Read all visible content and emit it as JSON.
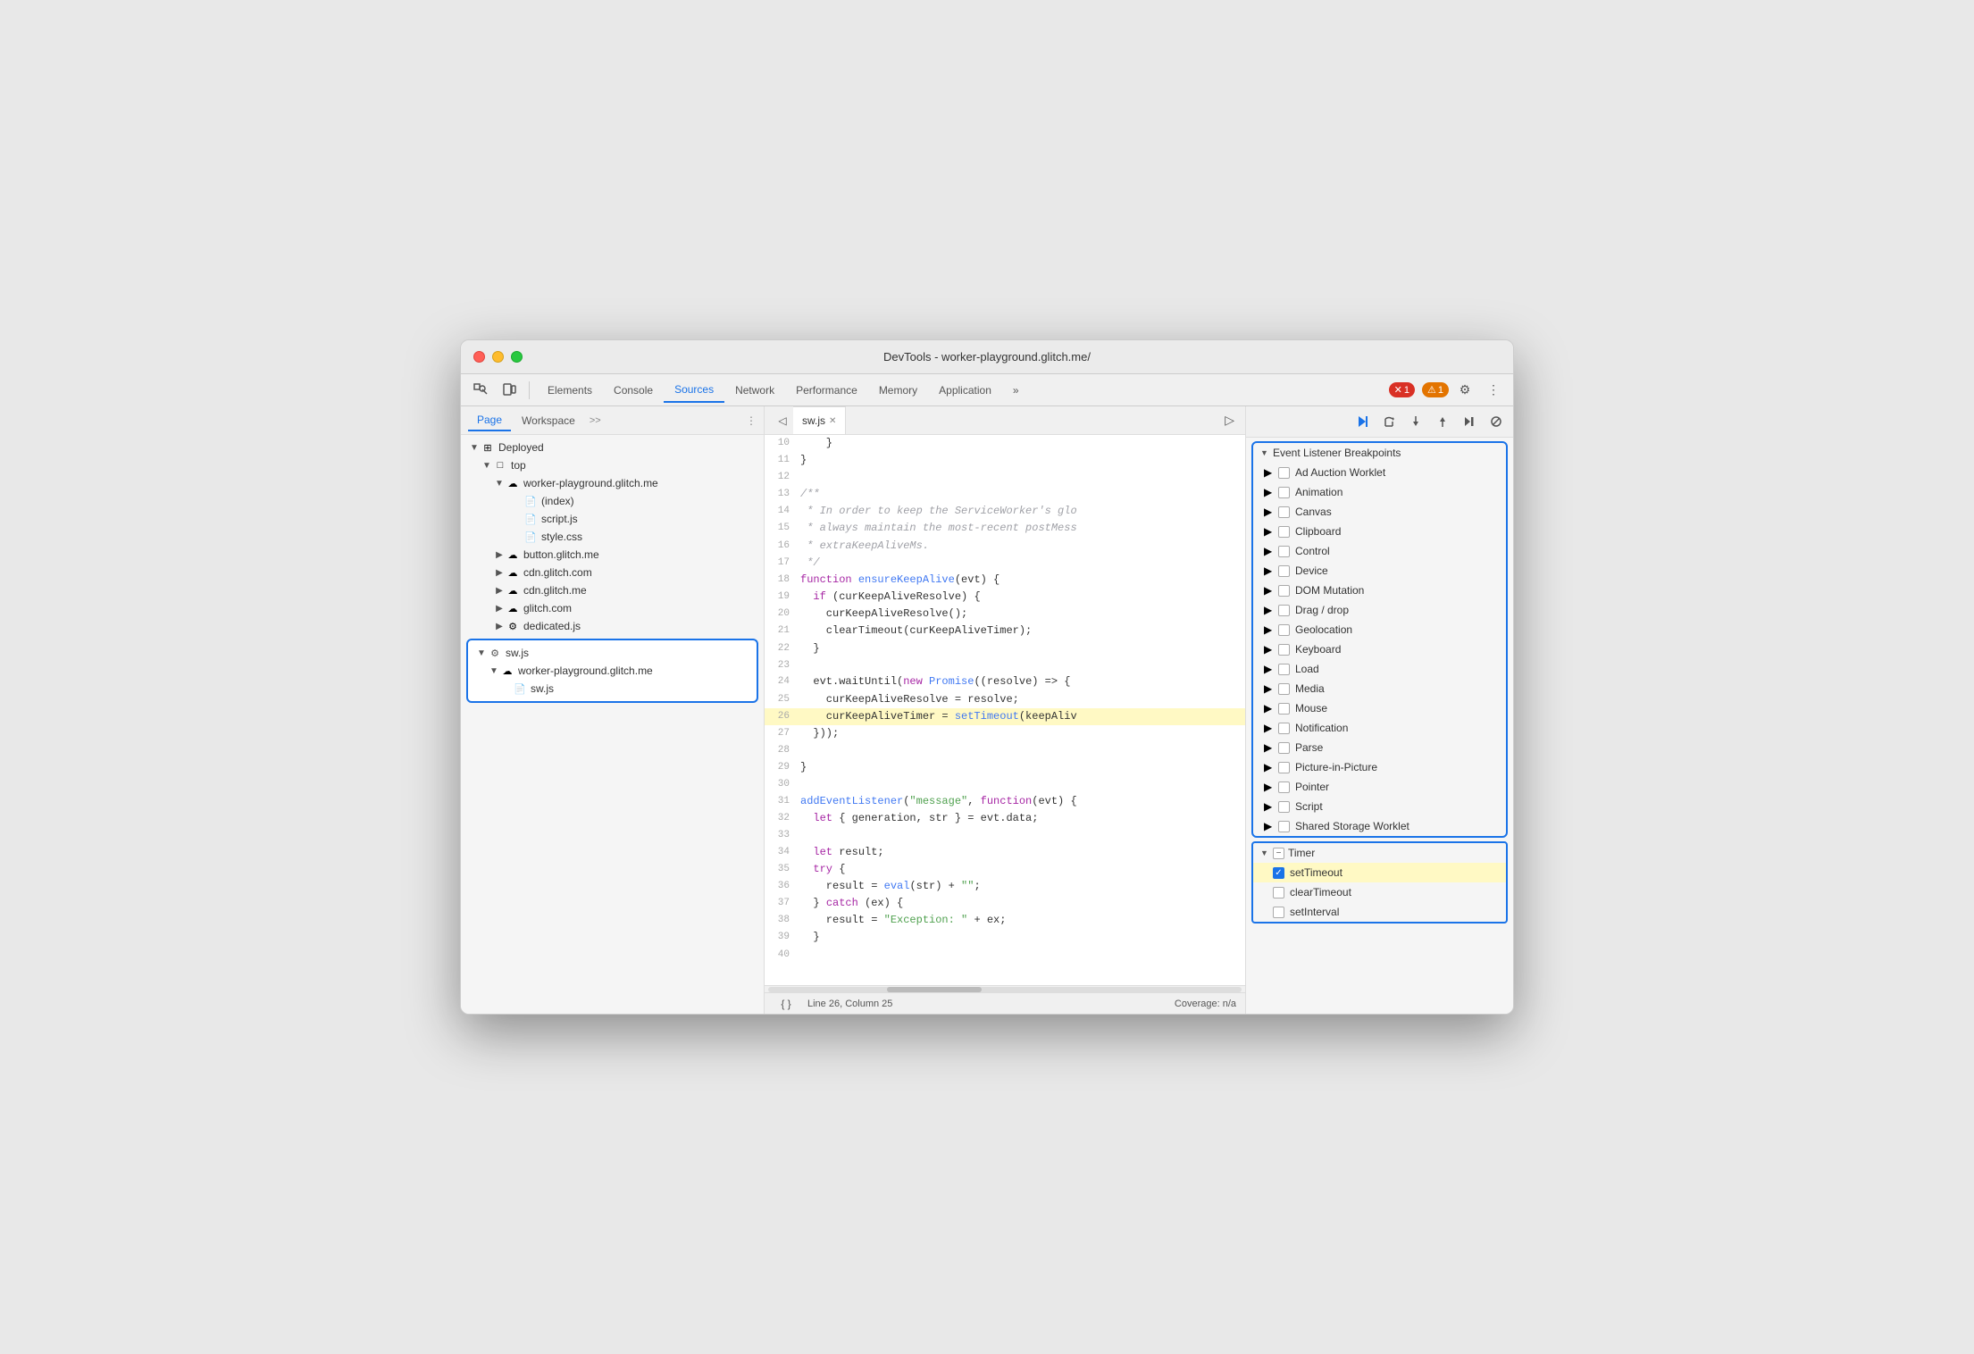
{
  "window": {
    "title": "DevTools - worker-playground.glitch.me/"
  },
  "toolbar": {
    "tabs": [
      "Elements",
      "Console",
      "Sources",
      "Network",
      "Performance",
      "Memory",
      "Application"
    ],
    "active_tab": "Sources",
    "more_label": "»",
    "error_count": "1",
    "warning_count": "1"
  },
  "panel_tabs": {
    "left": [
      "Page",
      "Workspace"
    ],
    "active": "Page",
    "more": ">>"
  },
  "file_tree": {
    "items": [
      {
        "id": "deployed",
        "label": "Deployed",
        "level": 0,
        "arrow": "▼",
        "icon": "box"
      },
      {
        "id": "top",
        "label": "top",
        "level": 1,
        "arrow": "▼",
        "icon": "page"
      },
      {
        "id": "worker-playground",
        "label": "worker-playground.glitch.me",
        "level": 2,
        "arrow": "▼",
        "icon": "cloud"
      },
      {
        "id": "index",
        "label": "(index)",
        "level": 3,
        "icon": "file"
      },
      {
        "id": "script-js",
        "label": "script.js",
        "level": 3,
        "icon": "js-file"
      },
      {
        "id": "style-css",
        "label": "style.css",
        "level": 3,
        "icon": "css-file"
      },
      {
        "id": "button-glitch",
        "label": "button.glitch.me",
        "level": 2,
        "arrow": "▶",
        "icon": "cloud"
      },
      {
        "id": "cdn-glitch-com",
        "label": "cdn.glitch.com",
        "level": 2,
        "arrow": "▶",
        "icon": "cloud"
      },
      {
        "id": "cdn-glitch-me",
        "label": "cdn.glitch.me",
        "level": 2,
        "arrow": "▶",
        "icon": "cloud"
      },
      {
        "id": "glitch-com",
        "label": "glitch.com",
        "level": 2,
        "arrow": "▶",
        "icon": "cloud"
      },
      {
        "id": "dedicated-js",
        "label": "dedicated.js",
        "level": 2,
        "arrow": "▶",
        "icon": "gear-file"
      },
      {
        "id": "sw-js-group",
        "label": "sw.js",
        "level": 1,
        "arrow": "▼",
        "icon": "gear-file",
        "selected": true
      },
      {
        "id": "worker-playground-2",
        "label": "worker-playground.glitch.me",
        "level": 2,
        "arrow": "▼",
        "icon": "cloud",
        "selected": true
      },
      {
        "id": "sw-js-file",
        "label": "sw.js",
        "level": 3,
        "icon": "file",
        "selected": true
      }
    ]
  },
  "code_editor": {
    "tab_name": "sw.js",
    "lines": [
      {
        "num": 10,
        "content": "    }"
      },
      {
        "num": 11,
        "content": "}"
      },
      {
        "num": 12,
        "content": ""
      },
      {
        "num": 13,
        "content": "/**"
      },
      {
        "num": 14,
        "content": " * In order to keep the ServiceWorker's glo"
      },
      {
        "num": 15,
        "content": " * always maintain the most-recent postMess"
      },
      {
        "num": 16,
        "content": " * extraKeepAliveMs."
      },
      {
        "num": 17,
        "content": " */"
      },
      {
        "num": 18,
        "content": "function ensureKeepAlive(evt) {",
        "tokens": [
          {
            "text": "function",
            "cls": "kw"
          },
          {
            "text": " ensureKeepAlive(evt) {",
            "cls": "fn"
          }
        ]
      },
      {
        "num": 19,
        "content": "  if (curKeepAliveResolve) {",
        "tokens": [
          {
            "text": "  ",
            "cls": ""
          },
          {
            "text": "if",
            "cls": "kw"
          },
          {
            "text": " (curKeepAliveResolve) {",
            "cls": ""
          }
        ]
      },
      {
        "num": 20,
        "content": "    curKeepAliveResolve();"
      },
      {
        "num": 21,
        "content": "    clearTimeout(curKeepAliveTimer);"
      },
      {
        "num": 22,
        "content": "  }"
      },
      {
        "num": 23,
        "content": ""
      },
      {
        "num": 24,
        "content": "  evt.waitUntil(new Promise((resolve) => {"
      },
      {
        "num": 25,
        "content": "    curKeepAliveResolve = resolve;"
      },
      {
        "num": 26,
        "content": "    curKeepAliveTimer = setTimeout(keepAliv",
        "highlighted": true
      },
      {
        "num": 27,
        "content": "  }));"
      },
      {
        "num": 28,
        "content": ""
      },
      {
        "num": 29,
        "content": "}"
      },
      {
        "num": 30,
        "content": ""
      },
      {
        "num": 31,
        "content": "addEventListener(\"message\", function(evt) {"
      },
      {
        "num": 32,
        "content": "  let { generation, str } = evt.data;"
      },
      {
        "num": 33,
        "content": ""
      },
      {
        "num": 34,
        "content": "  let result;"
      },
      {
        "num": 35,
        "content": "  try {"
      },
      {
        "num": 36,
        "content": "    result = eval(str) + \"\";"
      },
      {
        "num": 37,
        "content": "  } catch (ex) {"
      },
      {
        "num": 38,
        "content": "    result = \"Exception: \" + ex;"
      },
      {
        "num": 39,
        "content": "  }"
      },
      {
        "num": 40,
        "content": ""
      }
    ]
  },
  "status_bar": {
    "format_btn": "{ }",
    "position": "Line 26, Column 25",
    "coverage": "Coverage: n/a"
  },
  "breakpoints": {
    "section_title": "Event Listener Breakpoints",
    "items": [
      {
        "label": "Ad Auction Worklet",
        "checked": false,
        "expandable": true
      },
      {
        "label": "Animation",
        "checked": false,
        "expandable": true
      },
      {
        "label": "Canvas",
        "checked": false,
        "expandable": true
      },
      {
        "label": "Clipboard",
        "checked": false,
        "expandable": true
      },
      {
        "label": "Control",
        "checked": false,
        "expandable": true
      },
      {
        "label": "Device",
        "checked": false,
        "expandable": true
      },
      {
        "label": "DOM Mutation",
        "checked": false,
        "expandable": true
      },
      {
        "label": "Drag / drop",
        "checked": false,
        "expandable": true
      },
      {
        "label": "Geolocation",
        "checked": false,
        "expandable": true
      },
      {
        "label": "Keyboard",
        "checked": false,
        "expandable": true
      },
      {
        "label": "Load",
        "checked": false,
        "expandable": true
      },
      {
        "label": "Media",
        "checked": false,
        "expandable": true
      },
      {
        "label": "Mouse",
        "checked": false,
        "expandable": true
      },
      {
        "label": "Notification",
        "checked": false,
        "expandable": true
      },
      {
        "label": "Parse",
        "checked": false,
        "expandable": true
      },
      {
        "label": "Picture-in-Picture",
        "checked": false,
        "expandable": true
      },
      {
        "label": "Pointer",
        "checked": false,
        "expandable": true
      },
      {
        "label": "Script",
        "checked": false,
        "expandable": true
      },
      {
        "label": "Shared Storage Worklet",
        "checked": false,
        "expandable": true
      }
    ],
    "timer_section": {
      "label": "Timer",
      "expanded": true,
      "items": [
        {
          "label": "setTimeout",
          "checked": true
        },
        {
          "label": "clearTimeout",
          "checked": false
        },
        {
          "label": "setInterval",
          "checked": false
        }
      ]
    }
  },
  "debug_toolbar": {
    "buttons": [
      "resume",
      "step-over",
      "step-into",
      "step-out",
      "step",
      "deactivate"
    ]
  }
}
